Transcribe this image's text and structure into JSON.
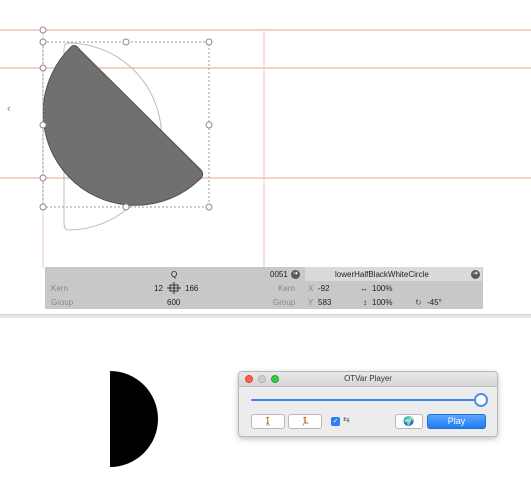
{
  "canvas": {
    "nav_left_glyph": "‹",
    "colors": {
      "metric_line": "#f0a090",
      "glyph_fill": "#707070",
      "background_glyph_stroke": "#bbbbbb"
    }
  },
  "info_panel": {
    "left": {
      "glyph_name": "Q",
      "kern_label": "Kern",
      "group_label": "Group",
      "kern_left": "12",
      "kern_right": "166",
      "width": "600"
    },
    "right": {
      "unicode": "0051",
      "glyph_name": "lowerHalfBlackWhiteCircle",
      "kern_label": "Kern",
      "group_label": "Group",
      "x_label": "X",
      "x_value": "-92",
      "y_label": "Y",
      "y_value": "583",
      "scale_h": "100%",
      "scale_v": "100%",
      "rotation": "-45°"
    }
  },
  "player": {
    "title": "OTVar Player",
    "slider_value": 1.0,
    "play_label": "Play",
    "checkbox_checked": true,
    "link_glyph": "⇆",
    "globe_icon": "🌍",
    "step_back_glyph": "🚶",
    "step_forward_glyph": "🏃"
  }
}
